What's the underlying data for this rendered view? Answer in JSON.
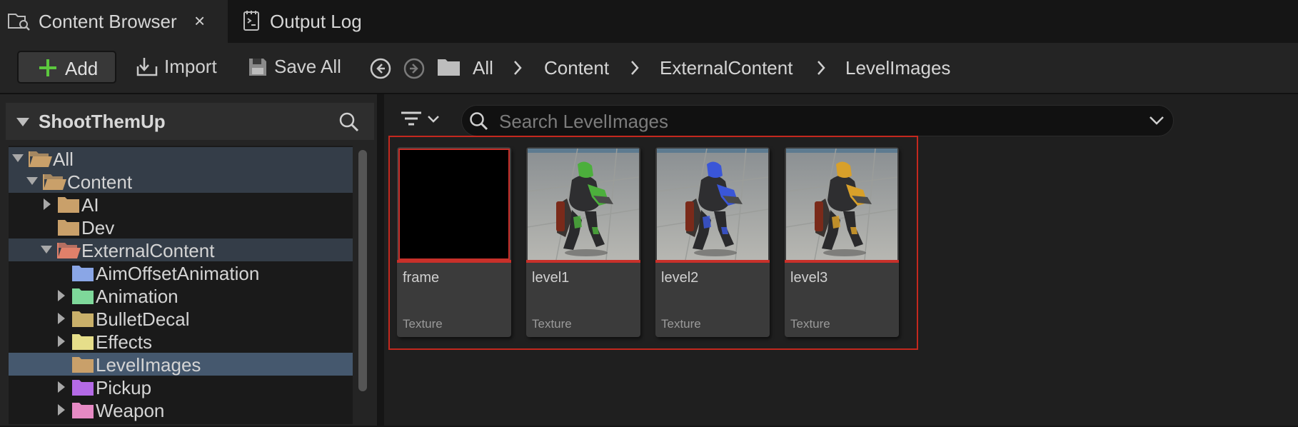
{
  "tabs": [
    {
      "label": "Content Browser",
      "icon": "content-browser-icon",
      "close": "×"
    },
    {
      "label": "Output Log",
      "icon": "output-log-icon"
    }
  ],
  "toolbar": {
    "add_label": "Add",
    "import_label": "Import",
    "save_all_label": "Save All"
  },
  "breadcrumb": [
    "All",
    "Content",
    "ExternalContent",
    "LevelImages"
  ],
  "sidebar": {
    "title": "ShootThemUp",
    "tree": [
      {
        "label": "All",
        "folder_color": "#c9a06a",
        "selected": "dim"
      },
      {
        "label": "Content",
        "folder_color": "#c9a06a",
        "selected": "dim"
      },
      {
        "label": "AI",
        "folder_color": "#c9a06a"
      },
      {
        "label": "Dev",
        "folder_color": "#c9a06a"
      },
      {
        "label": "ExternalContent",
        "folder_color": "#e0806a",
        "selected": "dim"
      },
      {
        "label": "AimOffsetAnimation",
        "folder_color": "#8aa6e6"
      },
      {
        "label": "Animation",
        "folder_color": "#7ed89a"
      },
      {
        "label": "BulletDecal",
        "folder_color": "#c9b06a"
      },
      {
        "label": "Effects",
        "folder_color": "#e6de8a"
      },
      {
        "label": "LevelImages",
        "folder_color": "#c9a06a",
        "selected": "active"
      },
      {
        "label": "Pickup",
        "folder_color": "#b46ae6"
      },
      {
        "label": "Weapon",
        "folder_color": "#e68ac4"
      }
    ]
  },
  "search": {
    "placeholder": "Search LevelImages"
  },
  "assets": [
    {
      "name": "frame",
      "type": "Texture"
    },
    {
      "name": "level1",
      "type": "Texture",
      "accent": "#4caf3c"
    },
    {
      "name": "level2",
      "type": "Texture",
      "accent": "#3a56d8"
    },
    {
      "name": "level3",
      "type": "Texture",
      "accent": "#d8a02a"
    }
  ]
}
